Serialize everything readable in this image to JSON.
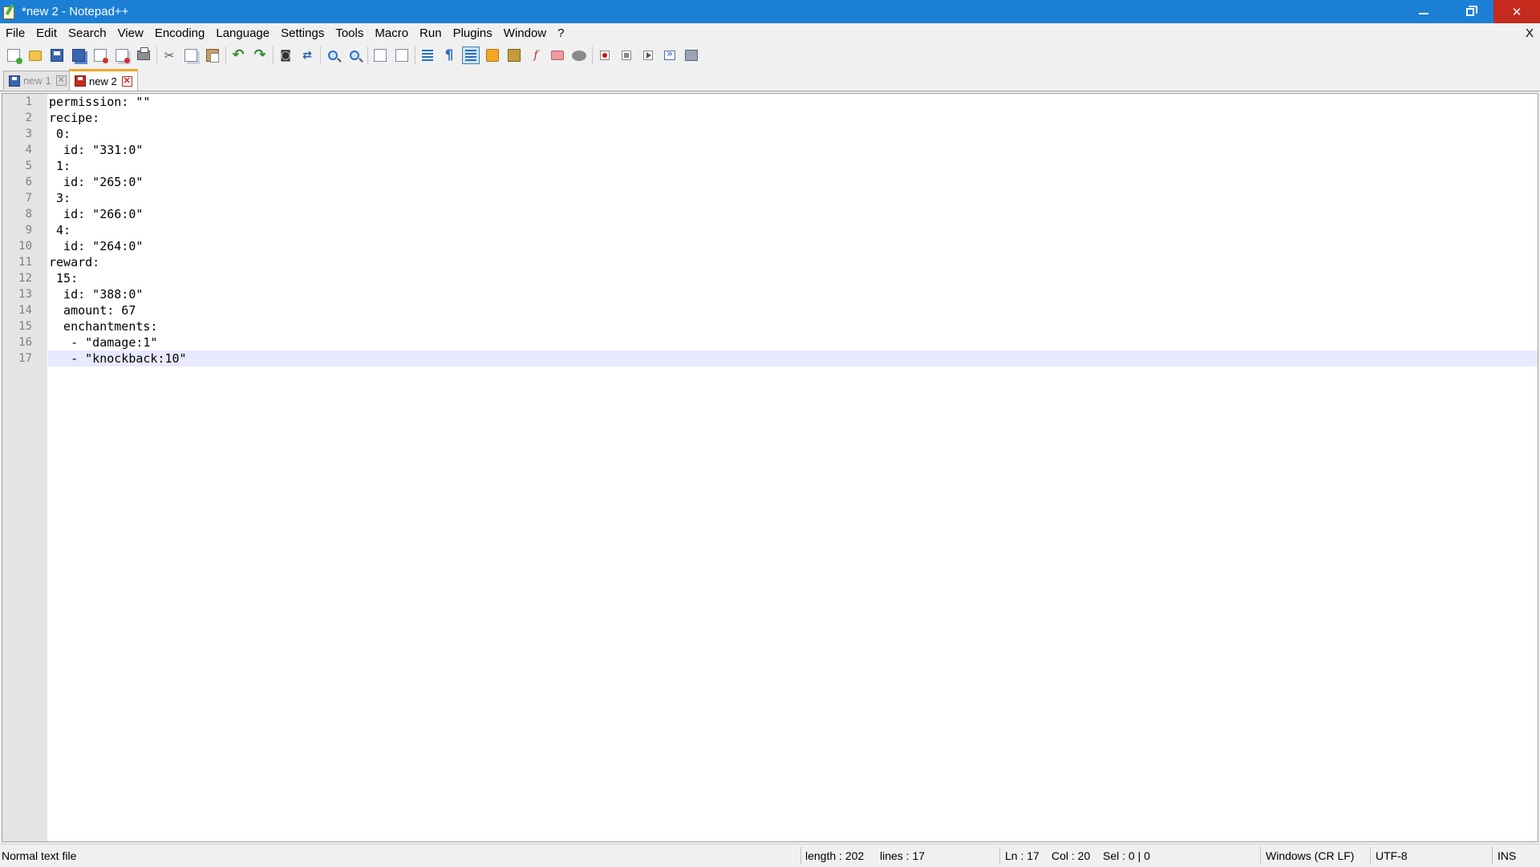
{
  "window": {
    "title": "*new 2 - Notepad++",
    "close_doc_label": "X"
  },
  "menu": {
    "items": [
      "File",
      "Edit",
      "Search",
      "View",
      "Encoding",
      "Language",
      "Settings",
      "Tools",
      "Macro",
      "Run",
      "Plugins",
      "Window",
      "?"
    ]
  },
  "toolbar": {
    "icons": [
      "new-file-icon",
      "open-file-icon",
      "save-icon",
      "save-all-icon",
      "close-icon",
      "close-all-icon",
      "print-icon",
      "cut-icon",
      "copy-icon",
      "paste-icon",
      "undo-icon",
      "redo-icon",
      "find-icon",
      "replace-icon",
      "zoom-in-icon",
      "zoom-out-icon",
      "sync-vertical-icon",
      "sync-horizontal-icon",
      "word-wrap-icon",
      "show-all-characters-icon",
      "indent-guide-icon",
      "user-defined-language-icon",
      "document-map-icon",
      "function-list-icon",
      "folder-as-workspace-icon",
      "monitoring-icon",
      "record-macro-icon",
      "stop-recording-icon",
      "playback-macro-icon",
      "run-macro-multiple-icon",
      "save-macro-icon"
    ]
  },
  "tabs": [
    {
      "label": "new 1",
      "active": false
    },
    {
      "label": "new 2",
      "active": true
    }
  ],
  "editor": {
    "current_line": 17,
    "lines": [
      "permission: \"\"",
      "recipe:",
      " 0:",
      "  id: \"331:0\"",
      " 1:",
      "  id: \"265:0\"",
      " 3:",
      "  id: \"266:0\"",
      " 4:",
      "  id: \"264:0\"",
      "reward:",
      " 15:",
      "  id: \"388:0\"",
      "  amount: 67",
      "  enchantments:",
      "   - \"damage:1\"",
      "   - \"knockback:10\""
    ]
  },
  "status": {
    "file_type": "Normal text file",
    "length": "length : 202",
    "lines": "lines : 17",
    "ln": "Ln : 17",
    "col": "Col : 20",
    "sel": "Sel : 0 | 0",
    "eol": "Windows (CR LF)",
    "encoding": "UTF-8",
    "mode": "INS"
  },
  "colors": {
    "titlebar": "#1b7fd6",
    "close_button": "#c42b1c",
    "current_line": "#e8e8ff",
    "active_tab_accent": "#f5a623"
  }
}
